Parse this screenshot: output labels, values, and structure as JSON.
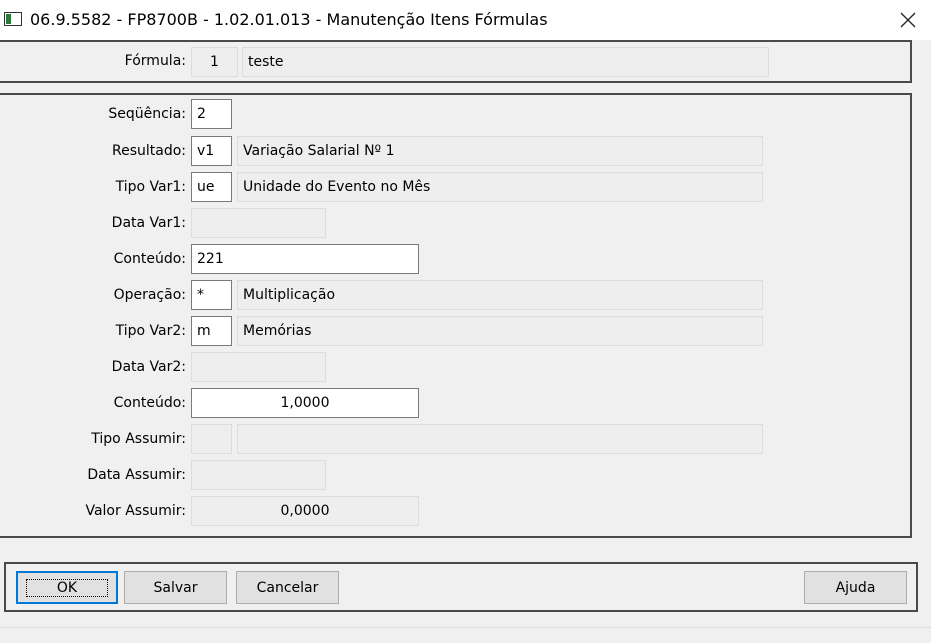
{
  "window": {
    "title": "06.9.5582 - FP8700B - 1.02.01.013 - Manutenção Itens Fórmulas"
  },
  "formula": {
    "label": "Fórmula:",
    "code": "1",
    "name": "teste"
  },
  "fields": {
    "sequencia": {
      "label": "Seqüência:",
      "value": "2"
    },
    "resultado": {
      "label": "Resultado:",
      "code": "v1",
      "desc": "Variação Salarial Nº 1"
    },
    "tipo_var1": {
      "label": "Tipo Var1:",
      "code": "ue",
      "desc": "Unidade do Evento no Mês"
    },
    "data_var1": {
      "label": "Data Var1:",
      "value": ""
    },
    "conteudo1": {
      "label": "Conteúdo:",
      "value": "221"
    },
    "operacao": {
      "label": "Operação:",
      "code": "*",
      "desc": "Multiplicação"
    },
    "tipo_var2": {
      "label": "Tipo Var2:",
      "code": "m",
      "desc": "Memórias"
    },
    "data_var2": {
      "label": "Data Var2:",
      "value": ""
    },
    "conteudo2": {
      "label": "Conteúdo:",
      "value": "1,0000"
    },
    "tipo_assumir": {
      "label": "Tipo Assumir:",
      "code": "",
      "desc": ""
    },
    "data_assumir": {
      "label": "Data Assumir:",
      "value": ""
    },
    "valor_assumir": {
      "label": "Valor Assumir:",
      "value": "0,0000"
    }
  },
  "buttons": {
    "ok": "OK",
    "salvar": "Salvar",
    "cancelar": "Cancelar",
    "ajuda": "Ajuda"
  },
  "icons": {
    "close": "close-icon",
    "app": "app-icon"
  },
  "colors": {
    "default_button_border": "#0078d7",
    "readonly_bg": "#eeeeee"
  }
}
